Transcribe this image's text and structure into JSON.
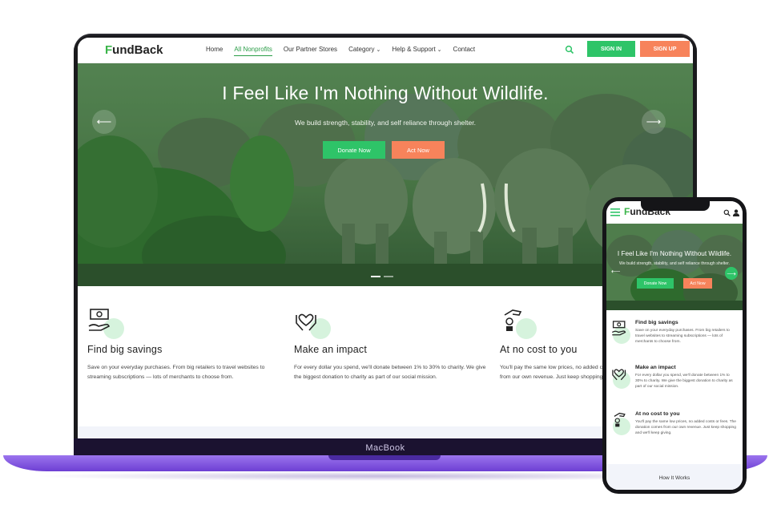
{
  "brand": {
    "logo_initial": "F",
    "logo_rest": "undBack",
    "primary_color": "#2ec468",
    "accent_color": "#f7835b",
    "device_base_color": "#7b4fe0"
  },
  "laptop": {
    "device_label": "MacBook",
    "nav": {
      "links": [
        {
          "label": "Home"
        },
        {
          "label": "All Nonprofits"
        },
        {
          "label": "Our Partner Stores"
        },
        {
          "label": "Category",
          "chevron": "⌄"
        },
        {
          "label": "Help & Support",
          "chevron": "⌄"
        },
        {
          "label": "Contact"
        }
      ],
      "signin_label": "SIGN IN",
      "signup_label": "SIGN UP"
    },
    "hero": {
      "title": "I Feel Like I'm Nothing Without Wildlife.",
      "subtitle": "We build strength, stability, and self reliance through shelter.",
      "donate_label": "Donate Now",
      "act_label": "Act Now",
      "prev_arrow": "⟵",
      "next_arrow": "⟶"
    },
    "features": [
      {
        "title": "Find big savings",
        "icon": "money-hand-icon",
        "text": "Save on your everyday purchases. From big retailers to travel websites to streaming subscriptions — lots of merchants to choose from."
      },
      {
        "title": "Make an impact",
        "icon": "heart-hands-icon",
        "text": "For every dollar you spend, we'll donate between 1% to 30% to charity. We give the biggest donation to charity as part of our social mission."
      },
      {
        "title": "At no cost to you",
        "icon": "hand-coin-icon",
        "text": "You'll pay the same low prices, no added costs or fees. The donation comes from our own revenue. Just keep shopping and we'll keep giving."
      }
    ]
  },
  "phone": {
    "hero": {
      "title": "I Feel Like I'm Nothing Without Wildlife.",
      "subtitle": "We build strength, stability, and self reliance through shelter.",
      "donate_label": "Donate Now",
      "act_label": "Act Now",
      "prev_arrow": "⟵",
      "next_arrow": "⟶"
    },
    "features": [
      {
        "title": "Find big savings",
        "text": "Save on your everyday purchases. From big retailers to travel websites to streaming subscriptions — lots of merchants to choose from."
      },
      {
        "title": "Make an impact",
        "text": "For every dollar you spend, we'll donate between 1% to 30% to charity. We give the biggest donation to charity as part of our social mission."
      },
      {
        "title": "At no cost to you",
        "text": "You'll pay the same low prices, no added costs or fees. The donation comes from our own revenue. Just keep shopping and we'll keep giving."
      }
    ],
    "footer_label": "How It Works"
  }
}
